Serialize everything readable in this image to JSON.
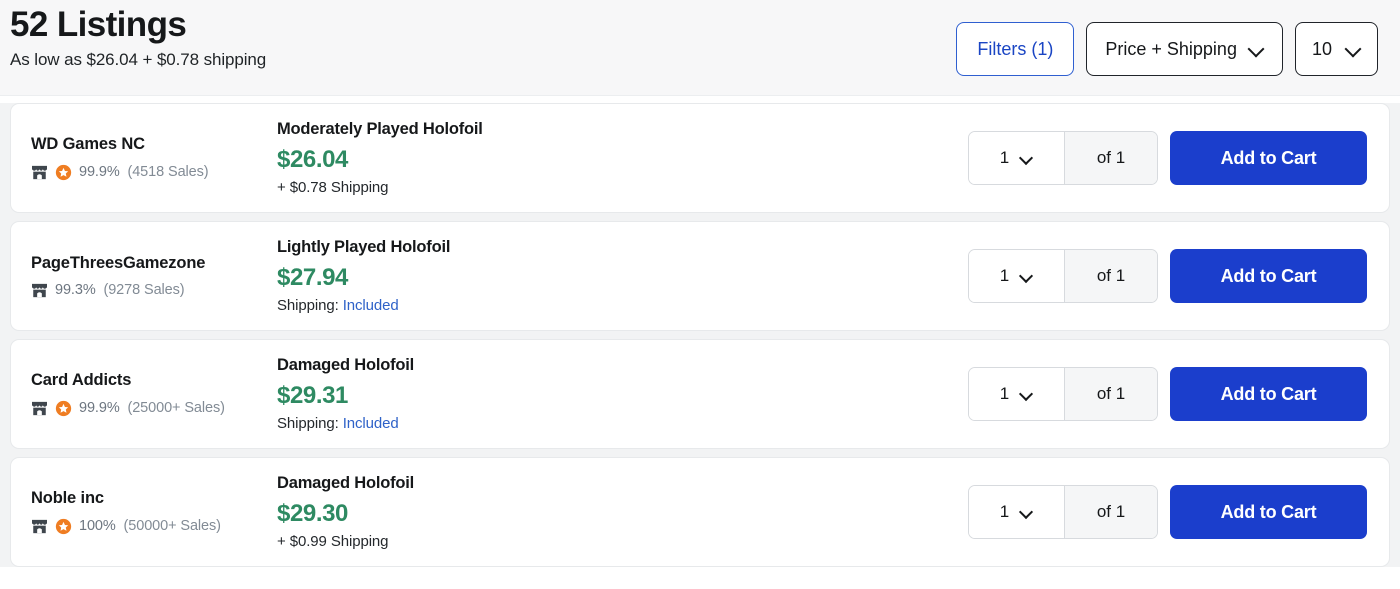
{
  "header": {
    "title": "52 Listings",
    "subtitle": "As low as $26.04 + $0.78 shipping",
    "filters_label": "Filters (1)",
    "sort_label": "Price + Shipping",
    "page_size_label": "10",
    "chevron_icon": "chevron-down-icon",
    "accent_blue": "#1a45c4",
    "background": "#f7f7f8"
  },
  "colors": {
    "price_green": "#2e8a62",
    "cart_blue": "#1b3ecc",
    "link_blue": "#2f62c8",
    "gold_badge_orange": "#ef7d22",
    "meta_gray": "#6d7680"
  },
  "listings": [
    {
      "seller": "WD Games NC",
      "shop_icon": "storefront-icon",
      "gold_badge": true,
      "gold_icon": "gold-star-badge-icon",
      "rating": "99.9%",
      "sales": "(4518 Sales)",
      "condition": "Moderately Played Holofoil",
      "price": "$26.04",
      "shipping_prefix": "+ $0.78 Shipping",
      "shipping_label": "",
      "shipping_link": "",
      "qty_value": "1",
      "qty_total": "of 1",
      "cart_label": "Add to Cart"
    },
    {
      "seller": "PageThreesGamezone",
      "shop_icon": "storefront-icon",
      "gold_badge": false,
      "gold_icon": "",
      "rating": "99.3%",
      "sales": "(9278 Sales)",
      "condition": "Lightly Played Holofoil",
      "price": "$27.94",
      "shipping_prefix": "",
      "shipping_label": "Shipping: ",
      "shipping_link": "Included",
      "qty_value": "1",
      "qty_total": "of 1",
      "cart_label": "Add to Cart"
    },
    {
      "seller": "Card Addicts",
      "shop_icon": "storefront-icon",
      "gold_badge": true,
      "gold_icon": "gold-star-badge-icon",
      "rating": "99.9%",
      "sales": "(25000+ Sales)",
      "condition": "Damaged Holofoil",
      "price": "$29.31",
      "shipping_prefix": "",
      "shipping_label": "Shipping: ",
      "shipping_link": "Included",
      "qty_value": "1",
      "qty_total": "of 1",
      "cart_label": "Add to Cart"
    },
    {
      "seller": "Noble inc",
      "shop_icon": "storefront-icon",
      "gold_badge": true,
      "gold_icon": "gold-star-badge-icon",
      "rating": "100%",
      "sales": "(50000+ Sales)",
      "condition": "Damaged Holofoil",
      "price": "$29.30",
      "shipping_prefix": "+ $0.99 Shipping",
      "shipping_label": "",
      "shipping_link": "",
      "qty_value": "1",
      "qty_total": "of 1",
      "cart_label": "Add to Cart"
    }
  ]
}
